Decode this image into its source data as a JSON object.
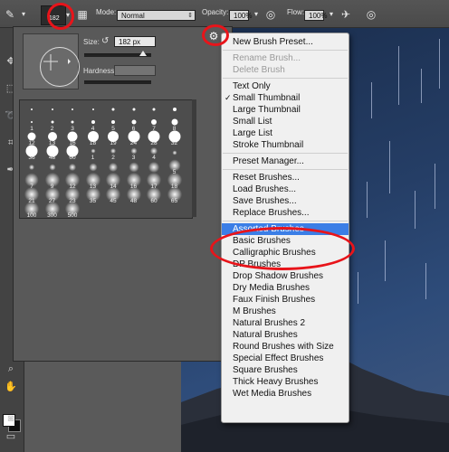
{
  "options_bar": {
    "brush_size_value": "182",
    "mode_label": "Mode:",
    "mode_value": "Normal",
    "opacity_label": "Opacity:",
    "opacity_value": "100%",
    "flow_label": "Flow:",
    "flow_value": "100%"
  },
  "picker": {
    "size_label": "Size:",
    "size_value": "182 px",
    "hardness_label": "Hardness:",
    "brushes": [
      {
        "label": "",
        "size": 2,
        "soft": false
      },
      {
        "label": "",
        "size": 2,
        "soft": false
      },
      {
        "label": "",
        "size": 2,
        "soft": false
      },
      {
        "label": "",
        "size": 2,
        "soft": false
      },
      {
        "label": "",
        "size": 3,
        "soft": false
      },
      {
        "label": "",
        "size": 3,
        "soft": false
      },
      {
        "label": "",
        "size": 3,
        "soft": false
      },
      {
        "label": "",
        "size": 4,
        "soft": false
      },
      {
        "label": "1",
        "size": 2,
        "soft": false
      },
      {
        "label": "2",
        "size": 3,
        "soft": false
      },
      {
        "label": "3",
        "size": 3,
        "soft": false
      },
      {
        "label": "4",
        "size": 4,
        "soft": false
      },
      {
        "label": "5",
        "size": 4,
        "soft": false
      },
      {
        "label": "6",
        "size": 5,
        "soft": false
      },
      {
        "label": "7",
        "size": 6,
        "soft": false
      },
      {
        "label": "8",
        "size": 7,
        "soft": false
      },
      {
        "label": "12",
        "size": 9,
        "soft": false
      },
      {
        "label": "13",
        "size": 10,
        "soft": false
      },
      {
        "label": "16",
        "size": 11,
        "soft": false
      },
      {
        "label": "18",
        "size": 12,
        "soft": false
      },
      {
        "label": "19",
        "size": 12,
        "soft": false
      },
      {
        "label": "24",
        "size": 13,
        "soft": false
      },
      {
        "label": "28",
        "size": 14,
        "soft": false
      },
      {
        "label": "32",
        "size": 14,
        "soft": false
      },
      {
        "label": "36",
        "size": 16,
        "soft": false
      },
      {
        "label": "48",
        "size": 17,
        "soft": false
      },
      {
        "label": "60",
        "size": 18,
        "soft": false
      },
      {
        "label": "1",
        "size": 2,
        "soft": true
      },
      {
        "label": "2",
        "size": 3,
        "soft": true
      },
      {
        "label": "3",
        "size": 4,
        "soft": true
      },
      {
        "label": "4",
        "size": 5,
        "soft": true
      },
      {
        "label": "",
        "size": 2,
        "soft": true
      },
      {
        "label": "",
        "size": 3,
        "soft": true
      },
      {
        "label": "",
        "size": 4,
        "soft": true
      },
      {
        "label": "",
        "size": 5,
        "soft": true
      },
      {
        "label": "",
        "size": 6,
        "soft": true
      },
      {
        "label": "",
        "size": 7,
        "soft": true
      },
      {
        "label": "",
        "size": 8,
        "soft": true
      },
      {
        "label": "",
        "size": 9,
        "soft": true
      },
      {
        "label": "5",
        "size": 10,
        "soft": true
      },
      {
        "label": "7",
        "size": 12,
        "soft": true
      },
      {
        "label": "9",
        "size": 13,
        "soft": true
      },
      {
        "label": "12",
        "size": 14,
        "soft": true
      },
      {
        "label": "13",
        "size": 15,
        "soft": true
      },
      {
        "label": "14",
        "size": 16,
        "soft": true
      },
      {
        "label": "16",
        "size": 17,
        "soft": true
      },
      {
        "label": "17",
        "size": 18,
        "soft": true
      },
      {
        "label": "18",
        "size": 18,
        "soft": true
      },
      {
        "label": "21",
        "size": 19,
        "soft": true
      },
      {
        "label": "27",
        "size": 19,
        "soft": true
      },
      {
        "label": "23",
        "size": 20,
        "soft": true
      },
      {
        "label": "35",
        "size": 20,
        "soft": true
      },
      {
        "label": "45",
        "size": 21,
        "soft": true
      },
      {
        "label": "48",
        "size": 21,
        "soft": true
      },
      {
        "label": "60",
        "size": 22,
        "soft": true
      },
      {
        "label": "65",
        "size": 22,
        "soft": true
      },
      {
        "label": "100",
        "size": 22,
        "soft": true
      },
      {
        "label": "300",
        "size": 22,
        "soft": true
      },
      {
        "label": "500",
        "size": 22,
        "soft": true
      }
    ]
  },
  "menu": {
    "items": [
      {
        "label": "New Brush Preset...",
        "disabled": false,
        "checked": false,
        "selected": false
      },
      {
        "sep": true
      },
      {
        "label": "Rename Brush...",
        "disabled": true,
        "checked": false,
        "selected": false
      },
      {
        "label": "Delete Brush",
        "disabled": true,
        "checked": false,
        "selected": false
      },
      {
        "sep": true
      },
      {
        "label": "Text Only",
        "disabled": false,
        "checked": false,
        "selected": false
      },
      {
        "label": "Small Thumbnail",
        "disabled": false,
        "checked": true,
        "selected": false
      },
      {
        "label": "Large Thumbnail",
        "disabled": false,
        "checked": false,
        "selected": false
      },
      {
        "label": "Small List",
        "disabled": false,
        "checked": false,
        "selected": false
      },
      {
        "label": "Large List",
        "disabled": false,
        "checked": false,
        "selected": false
      },
      {
        "label": "Stroke Thumbnail",
        "disabled": false,
        "checked": false,
        "selected": false
      },
      {
        "sep": true
      },
      {
        "label": "Preset Manager...",
        "disabled": false,
        "checked": false,
        "selected": false
      },
      {
        "sep": true
      },
      {
        "label": "Reset Brushes...",
        "disabled": false,
        "checked": false,
        "selected": false
      },
      {
        "label": "Load Brushes...",
        "disabled": false,
        "checked": false,
        "selected": false
      },
      {
        "label": "Save Brushes...",
        "disabled": false,
        "checked": false,
        "selected": false
      },
      {
        "label": "Replace Brushes...",
        "disabled": false,
        "checked": false,
        "selected": false
      },
      {
        "sep": true
      },
      {
        "label": "Assorted Brushes",
        "disabled": false,
        "checked": false,
        "selected": true
      },
      {
        "label": "Basic Brushes",
        "disabled": false,
        "checked": false,
        "selected": false
      },
      {
        "label": "Calligraphic Brushes",
        "disabled": false,
        "checked": false,
        "selected": false
      },
      {
        "label": "DP Brushes",
        "disabled": false,
        "checked": false,
        "selected": false
      },
      {
        "label": "Drop Shadow Brushes",
        "disabled": false,
        "checked": false,
        "selected": false
      },
      {
        "label": "Dry Media Brushes",
        "disabled": false,
        "checked": false,
        "selected": false
      },
      {
        "label": "Faux Finish Brushes",
        "disabled": false,
        "checked": false,
        "selected": false
      },
      {
        "label": "M Brushes",
        "disabled": false,
        "checked": false,
        "selected": false
      },
      {
        "label": "Natural Brushes 2",
        "disabled": false,
        "checked": false,
        "selected": false
      },
      {
        "label": "Natural Brushes",
        "disabled": false,
        "checked": false,
        "selected": false
      },
      {
        "label": "Round Brushes with Size",
        "disabled": false,
        "checked": false,
        "selected": false
      },
      {
        "label": "Special Effect Brushes",
        "disabled": false,
        "checked": false,
        "selected": false
      },
      {
        "label": "Square Brushes",
        "disabled": false,
        "checked": false,
        "selected": false
      },
      {
        "label": "Thick Heavy Brushes",
        "disabled": false,
        "checked": false,
        "selected": false
      },
      {
        "label": "Wet Media Brushes",
        "disabled": false,
        "checked": false,
        "selected": false
      }
    ]
  },
  "colors": {
    "annotation": "#e8141a",
    "menu_highlight": "#3b7ee6"
  }
}
